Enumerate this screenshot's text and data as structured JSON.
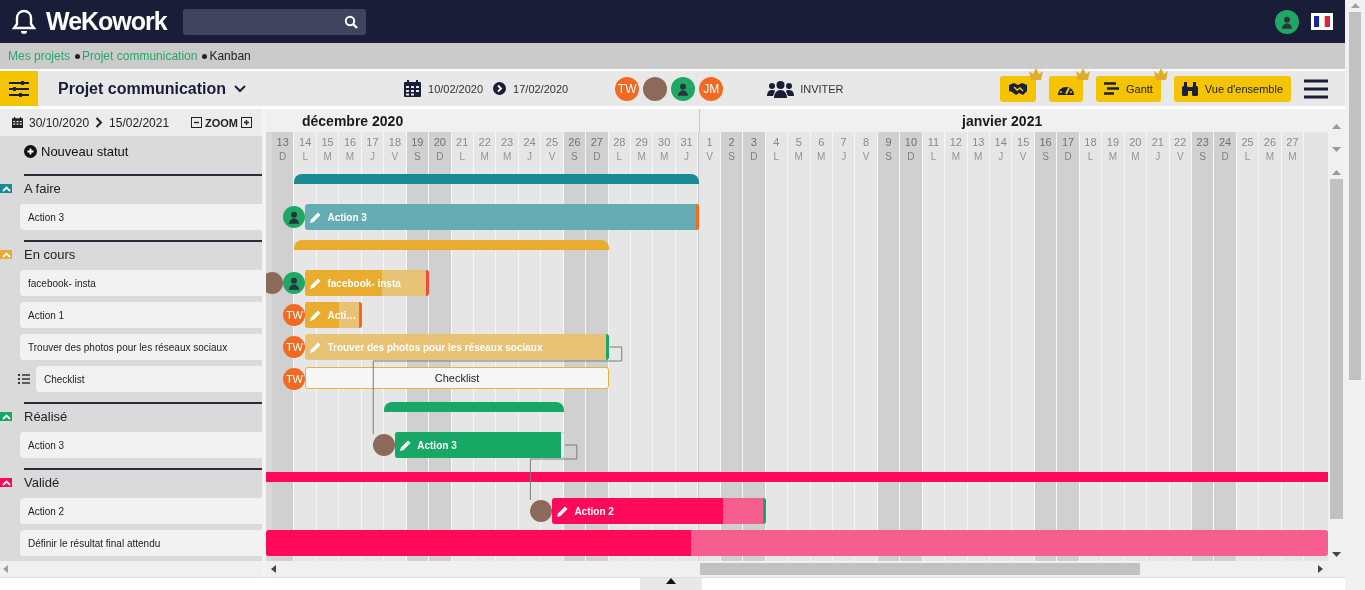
{
  "topbar": {
    "logo": "WeKowork",
    "user_avatar": {
      "kind": "silhouette"
    }
  },
  "breadcrumb": [
    {
      "label": "Mes projets",
      "link": true
    },
    {
      "label": "Projet communication",
      "link": true
    },
    {
      "label": "Kanban",
      "link": false
    }
  ],
  "toolbar": {
    "title": "Projet communication",
    "date_from": "10/02/2020",
    "date_to": "17/02/2020",
    "members": [
      {
        "kind": "initials",
        "initials": "TW"
      },
      {
        "kind": "photo"
      },
      {
        "kind": "silhouette"
      },
      {
        "kind": "initials",
        "initials": "JM"
      }
    ],
    "invite_label": "INVITER",
    "views": [
      {
        "kind": "handshake",
        "premium": true
      },
      {
        "kind": "gauge",
        "premium": true
      },
      {
        "kind": "gantt",
        "label": "Gantt",
        "premium": true
      },
      {
        "kind": "binoculars",
        "label": "Vue d'ensemble",
        "premium": false
      }
    ]
  },
  "gantt": {
    "range_from": "30/10/2020",
    "range_to": "15/02/2021",
    "zoom_label": "ZOOM",
    "new_status_label": "Nouveau statut",
    "months": [
      {
        "label": "décembre 2020",
        "days": [
          {
            "day": "13",
            "weekday": "D",
            "weekend": true
          },
          {
            "day": "14",
            "weekday": "L",
            "weekend": false
          },
          {
            "day": "15",
            "weekday": "M",
            "weekend": false
          },
          {
            "day": "16",
            "weekday": "M",
            "weekend": false
          },
          {
            "day": "17",
            "weekday": "J",
            "weekend": false
          },
          {
            "day": "18",
            "weekday": "V",
            "weekend": false
          },
          {
            "day": "19",
            "weekday": "S",
            "weekend": true
          },
          {
            "day": "20",
            "weekday": "D",
            "weekend": true
          },
          {
            "day": "21",
            "weekday": "L",
            "weekend": false
          },
          {
            "day": "22",
            "weekday": "M",
            "weekend": false
          },
          {
            "day": "23",
            "weekday": "M",
            "weekend": false
          },
          {
            "day": "24",
            "weekday": "J",
            "weekend": false
          },
          {
            "day": "25",
            "weekday": "V",
            "weekend": false
          },
          {
            "day": "26",
            "weekday": "S",
            "weekend": true
          },
          {
            "day": "27",
            "weekday": "D",
            "weekend": true
          },
          {
            "day": "28",
            "weekday": "L",
            "weekend": false
          },
          {
            "day": "29",
            "weekday": "M",
            "weekend": false
          },
          {
            "day": "30",
            "weekday": "M",
            "weekend": false
          },
          {
            "day": "31",
            "weekday": "J",
            "weekend": false
          }
        ]
      },
      {
        "label": "janvier 2021",
        "days": [
          {
            "day": "1",
            "weekday": "V",
            "weekend": false
          },
          {
            "day": "2",
            "weekday": "S",
            "weekend": true
          },
          {
            "day": "3",
            "weekday": "D",
            "weekend": true
          },
          {
            "day": "4",
            "weekday": "L",
            "weekend": false
          },
          {
            "day": "5",
            "weekday": "M",
            "weekend": false
          },
          {
            "day": "6",
            "weekday": "M",
            "weekend": false
          },
          {
            "day": "7",
            "weekday": "J",
            "weekend": false
          },
          {
            "day": "8",
            "weekday": "V",
            "weekend": false
          },
          {
            "day": "9",
            "weekday": "S",
            "weekend": true
          },
          {
            "day": "10",
            "weekday": "D",
            "weekend": true
          },
          {
            "day": "11",
            "weekday": "L",
            "weekend": false
          },
          {
            "day": "12",
            "weekday": "M",
            "weekend": false
          },
          {
            "day": "13",
            "weekday": "M",
            "weekend": false
          },
          {
            "day": "14",
            "weekday": "J",
            "weekend": false
          },
          {
            "day": "15",
            "weekday": "V",
            "weekend": false
          },
          {
            "day": "16",
            "weekday": "S",
            "weekend": true
          },
          {
            "day": "17",
            "weekday": "D",
            "weekend": true
          },
          {
            "day": "18",
            "weekday": "L",
            "weekend": false
          },
          {
            "day": "19",
            "weekday": "M",
            "weekend": false
          },
          {
            "day": "20",
            "weekday": "M",
            "weekend": false
          },
          {
            "day": "21",
            "weekday": "J",
            "weekend": false
          },
          {
            "day": "22",
            "weekday": "V",
            "weekend": false
          },
          {
            "day": "23",
            "weekday": "S",
            "weekend": true
          },
          {
            "day": "24",
            "weekday": "D",
            "weekend": true
          },
          {
            "day": "25",
            "weekday": "L",
            "weekend": false
          },
          {
            "day": "26",
            "weekday": "M",
            "weekend": false
          },
          {
            "day": "27",
            "weekday": "M",
            "weekend": false
          }
        ]
      }
    ],
    "statuses": [
      {
        "label": "A faire",
        "color": "#178a93",
        "expanded": true,
        "tasks": [
          {
            "kind": "task",
            "label": "Action 3",
            "bar_label": "Action 3",
            "level": 0,
            "color": "#f26a21",
            "assignees": [
              {
                "kind": "silhouette"
              }
            ]
          }
        ]
      },
      {
        "label": "En cours",
        "color": "#e9ac2f",
        "expanded": true,
        "tasks": [
          {
            "kind": "task",
            "label": "facebook- insta",
            "bar_label": "facebook- insta",
            "level": 0.62,
            "color": "#ef4b3a",
            "assignees": [
              {
                "kind": "silhouette"
              },
              {
                "kind": "photo"
              }
            ]
          },
          {
            "kind": "task",
            "label": "Action 1",
            "bar_label": "Acti…",
            "level": 0.6,
            "color": "#f26a21",
            "assignees": [
              {
                "kind": "initials",
                "initials": "TW"
              }
            ]
          },
          {
            "kind": "task",
            "label": "Trouver des photos pour les réseaux sociaux",
            "bar_label": "Trouver des photos pour les réseaux sociaux",
            "level": 0,
            "color": "#18a865",
            "assignees": [
              {
                "kind": "initials",
                "initials": "TW"
              }
            ]
          },
          {
            "kind": "checklist",
            "label": "Checklist",
            "bar_label": "Checklist",
            "assignees": [
              {
                "kind": "initials",
                "initials": "TW"
              }
            ]
          }
        ]
      },
      {
        "label": "Réalisé",
        "color": "#18a865",
        "expanded": true,
        "tasks": [
          {
            "kind": "task",
            "label": "Action 3",
            "bar_label": "Action 3",
            "level": 1,
            "color": "#e8f7ee",
            "assignees": [
              {
                "kind": "photo"
              }
            ]
          }
        ]
      },
      {
        "label": "Validé",
        "color": "#ff0a5a",
        "expanded": true,
        "tasks": [
          {
            "kind": "task",
            "label": "Action 2",
            "bar_label": "Action 2",
            "level": 0.8,
            "color": "#18a865",
            "assignees": [
              {
                "kind": "photo"
              }
            ]
          },
          {
            "kind": "task",
            "label": "Définir le résultat final attendu",
            "level": 0.4
          }
        ]
      }
    ]
  }
}
